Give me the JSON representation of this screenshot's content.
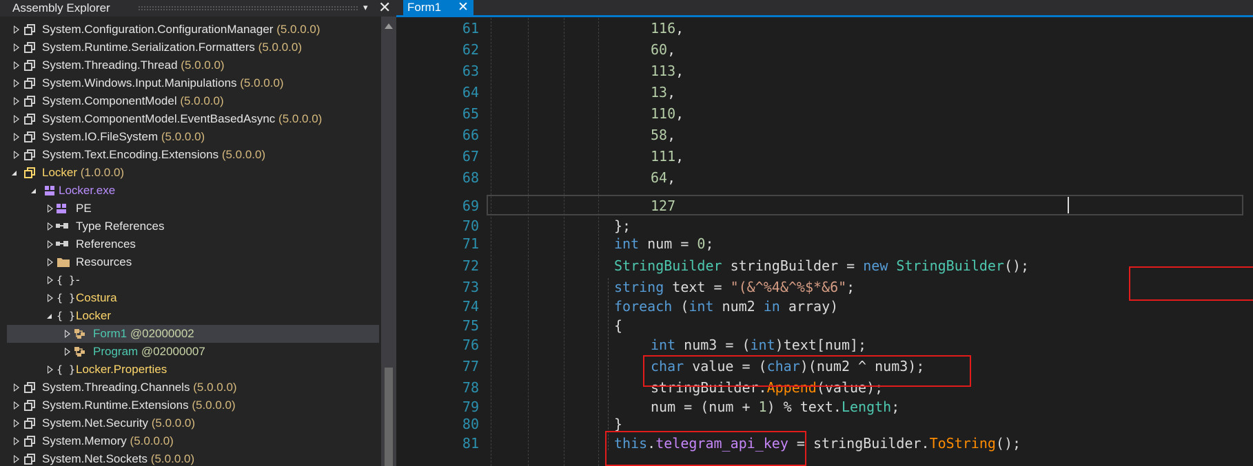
{
  "explorer": {
    "title": "Assembly Explorer",
    "menu_glyph": "▾",
    "close_glyph": "✕",
    "items": [
      {
        "label": "System.Configuration.ConfigurationManager",
        "version": "(5.0.0.0)",
        "icon": "assembly-icon"
      },
      {
        "label": "System.Runtime.Serialization.Formatters",
        "version": "(5.0.0.0)",
        "icon": "assembly-icon"
      },
      {
        "label": "System.Threading.Thread",
        "version": "(5.0.0.0)",
        "icon": "assembly-icon"
      },
      {
        "label": "System.Windows.Input.Manipulations",
        "version": "(5.0.0.0)",
        "icon": "assembly-icon"
      },
      {
        "label": "System.ComponentModel",
        "version": "(5.0.0.0)",
        "icon": "assembly-icon"
      },
      {
        "label": "System.ComponentModel.EventBasedAsync",
        "version": "(5.0.0.0)",
        "icon": "assembly-icon"
      },
      {
        "label": "System.IO.FileSystem",
        "version": "(5.0.0.0)",
        "icon": "assembly-icon"
      },
      {
        "label": "System.Text.Encoding.Extensions",
        "version": "(5.0.0.0)",
        "icon": "assembly-icon"
      },
      {
        "label": "Locker",
        "version": "(1.0.0.0)",
        "icon": "assembly-icon"
      },
      {
        "label": "Locker.exe",
        "icon": "module-icon"
      },
      {
        "label": "PE",
        "icon": "pe-icon"
      },
      {
        "label": "Type References",
        "icon": "type-references-icon"
      },
      {
        "label": "References",
        "icon": "references-icon"
      },
      {
        "label": "Resources",
        "icon": "folder-icon"
      },
      {
        "label": "-",
        "icon": "namespace-icon"
      },
      {
        "label": "Costura",
        "icon": "namespace-icon"
      },
      {
        "label": "Locker",
        "icon": "namespace-icon"
      },
      {
        "label": "Form1",
        "meta": "@02000002",
        "icon": "class-icon"
      },
      {
        "label": "Program",
        "meta": "@02000007",
        "icon": "class-icon"
      },
      {
        "label": "Locker.Properties",
        "icon": "namespace-icon"
      },
      {
        "label": "System.Threading.Channels",
        "version": "(5.0.0.0)",
        "icon": "assembly-icon"
      },
      {
        "label": "System.Runtime.Extensions",
        "version": "(5.0.0.0)",
        "icon": "assembly-icon"
      },
      {
        "label": "System.Net.Security",
        "version": "(5.0.0.0)",
        "icon": "assembly-icon"
      },
      {
        "label": "System.Memory",
        "version": "(5.0.0.0)",
        "icon": "assembly-icon"
      },
      {
        "label": "System.Net.Sockets",
        "version": "(5.0.0.0)",
        "icon": "assembly-icon"
      }
    ]
  },
  "editor": {
    "tab": {
      "label": "Form1",
      "close": "✕"
    },
    "lines": [
      {
        "n": "61",
        "v": "116",
        "p": ","
      },
      {
        "n": "62",
        "v": "60",
        "p": ","
      },
      {
        "n": "63",
        "v": "113",
        "p": ","
      },
      {
        "n": "64",
        "v": "13",
        "p": ","
      },
      {
        "n": "65",
        "v": "110",
        "p": ","
      },
      {
        "n": "66",
        "v": "58",
        "p": ","
      },
      {
        "n": "67",
        "v": "111",
        "p": ","
      },
      {
        "n": "68",
        "v": "64",
        "p": ","
      },
      {
        "n": "69",
        "v": "127",
        "p": ""
      },
      {
        "n": "70"
      },
      {
        "n": "71"
      },
      {
        "n": "72"
      },
      {
        "n": "73"
      },
      {
        "n": "74"
      },
      {
        "n": "75"
      },
      {
        "n": "76"
      },
      {
        "n": "77"
      },
      {
        "n": "78"
      },
      {
        "n": "79"
      },
      {
        "n": "80"
      },
      {
        "n": "81"
      }
    ],
    "tokens": {
      "close_array": "};",
      "int_kw": "int",
      "num_decl": " num = ",
      "zero": "0",
      "semicolon": ";",
      "sb_type": "StringBuilder",
      "sb_var": " stringBuilder = ",
      "new_kw": "new",
      "sb_ctor": "StringBuilder",
      "call_end": "();",
      "string_kw": "string",
      "text_decl": " text = ",
      "string_literal": "\"(&^%4&^%$*&6\"",
      "foreach_kw": "foreach",
      "paren_open": " (",
      "num2_part": " num2 ",
      "in_kw": "in",
      "array_part": " array)",
      "brace_open": "{",
      "num3_decl": " num3 = (",
      "cast_end": ")text[num];",
      "char_kw": "char",
      "value_decl": " value = (",
      "xor_expr": ")(num2 ^ num3);",
      "sb_append_obj": "stringBuilder.",
      "append_method": "Append",
      "append_args": "(value);",
      "num_update": "num = (num + ",
      "one": "1",
      "mod_part": ") % text.",
      "length_prop": "Length",
      "brace_close": "}",
      "this_kw": "this",
      "dot": ".",
      "api_key_field": "telegram_api_key",
      "assign_sb": " = stringBuilder.",
      "tostring_method": "ToString"
    }
  },
  "colors": {
    "accent": "#007acc",
    "highlight_box": "#e41b1b",
    "keyword": "#569cd6",
    "type": "#4ec9b0",
    "number": "#b5cea8",
    "string": "#d69d85",
    "method": "#ff8c00",
    "field": "#c586f8",
    "version": "#d7ba7d"
  }
}
